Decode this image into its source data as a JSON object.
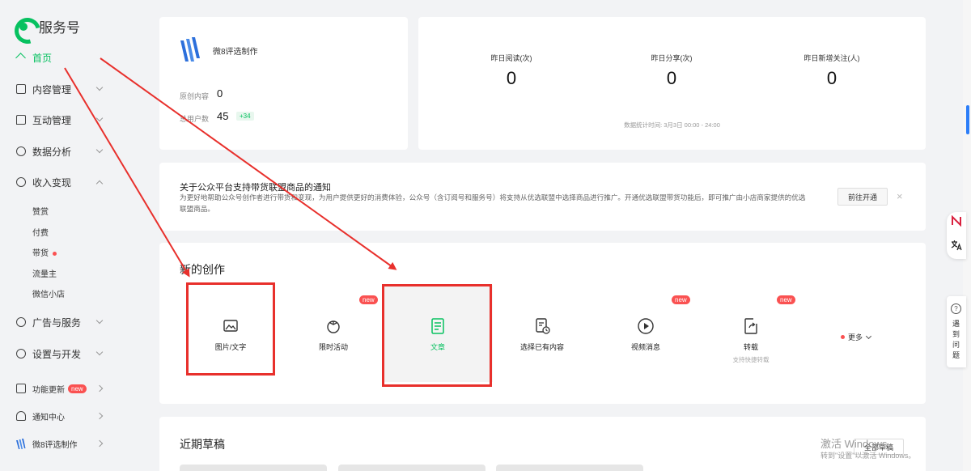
{
  "app": {
    "title": "服务号"
  },
  "sidebar": {
    "items": [
      {
        "label": "首页",
        "icon": "home-icon",
        "active": true
      },
      {
        "label": "内容管理",
        "icon": "document-icon"
      },
      {
        "label": "互动管理",
        "icon": "chat-icon"
      },
      {
        "label": "数据分析",
        "icon": "pie-chart-icon"
      },
      {
        "label": "收入变现",
        "icon": "coin-icon"
      },
      {
        "label": "广告与服务",
        "icon": "compass-icon"
      },
      {
        "label": "设置与开发",
        "icon": "gear-icon"
      },
      {
        "label": "功能更新",
        "icon": "update-icon",
        "badge": "new"
      },
      {
        "label": "通知中心",
        "icon": "bell-icon"
      },
      {
        "label": "微8评选制作",
        "icon": "account-avatar-icon"
      }
    ],
    "income_sub": [
      {
        "label": "赞赏"
      },
      {
        "label": "付费"
      },
      {
        "label": "带货"
      },
      {
        "label": "流量主"
      },
      {
        "label": "微信小店"
      }
    ]
  },
  "account": {
    "name": "微8评选制作",
    "original_label": "原创内容",
    "original_value": "0",
    "users_label": "总用户数",
    "users_value": "45",
    "users_delta": "+34"
  },
  "stats": {
    "items": [
      {
        "label": "昨日阅读(次)",
        "value": "0"
      },
      {
        "label": "昨日分享(次)",
        "value": "0"
      },
      {
        "label": "昨日新增关注(人)",
        "value": "0"
      }
    ],
    "period": "数据统计时间: 3月3日 00:00 - 24:00"
  },
  "notice": {
    "title": "关于公众平台支持带货联盟商品的通知",
    "body": "为更好地帮助公众号创作者进行带货和变现，为用户提供更好的消费体验，公众号（含订阅号和服务号）将支持从优选联盟中选择商品进行推广。开通优选联盟带货功能后，即可推广由小店商家提供的优选联盟商品。",
    "button": "前往开通",
    "close": "×"
  },
  "create": {
    "title": "新的创作",
    "items": [
      {
        "label": "图片/文字",
        "icon": "image-icon"
      },
      {
        "label": "限时活动",
        "icon": "tomato-icon",
        "badge": "new"
      },
      {
        "label": "文章",
        "icon": "article-icon"
      },
      {
        "label": "选择已有内容",
        "icon": "existing-content-icon"
      },
      {
        "label": "视频消息",
        "icon": "play-icon",
        "badge": "new"
      },
      {
        "label": "转载",
        "icon": "repost-icon",
        "badge": "new",
        "sub": "支持快捷转载"
      }
    ],
    "more": "更多"
  },
  "drafts": {
    "title": "近期草稿",
    "all_button": "全部草稿"
  },
  "right_rail": {
    "help_text": "遇到问题",
    "help_icon": "?"
  },
  "watermark": {
    "line1": "激活 Windows",
    "line2": "转到\"设置\"以激活 Windows。"
  },
  "colors": {
    "accent": "#07c160",
    "annotation": "#e8302c",
    "badge": "#fa5151"
  }
}
